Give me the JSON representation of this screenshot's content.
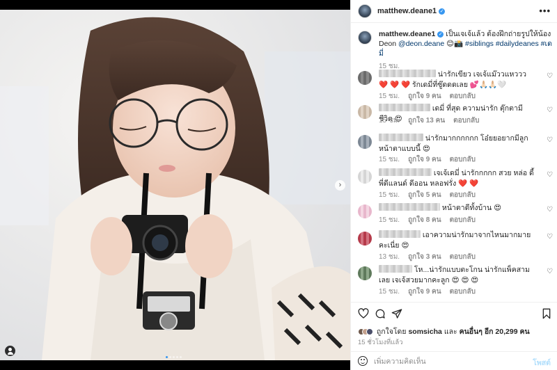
{
  "post": {
    "username": "matthew.deane1",
    "verified": true,
    "more_label": "•••"
  },
  "caption": {
    "username": "matthew.deane1",
    "text": "เป็นเจเจ้แล้ว ต้องฝึกถ่ายรูปให้น้อง Deon",
    "mention": "@deon.deane",
    "emoji": "😊📸",
    "hashtags": [
      "#siblings",
      "#dailydeanes",
      "#เดมี่"
    ],
    "time": "15 ชม."
  },
  "comments": [
    {
      "text": "น่ารักเขียว เจเจ้แม๊ววแหววว ❤️ ❤️ ❤️ รักเดมี่ที่ซู๊ดดดเลย 💕🙏🏻🙏🏻🤍",
      "time": "15 ชม.",
      "likes": "ถูกใจ 9 คน",
      "reply": "ตอบกลับ",
      "av_color": "#6b6b6b"
    },
    {
      "text": "เดมี่ ที่สุด ความน่ารัก ตุ๊กตามีชีวิต 😍",
      "time": "15 ชม.",
      "likes": "ถูกใจ 13 คน",
      "reply": "ตอบกลับ",
      "av_color": "#c9b8a6"
    },
    {
      "text": "น่ารักมากกกกกก โอ๋ยยอยากมีลูกหน้าตาแบบนี้ 😍",
      "time": "15 ชม.",
      "likes": "ถูกใจ 9 คน",
      "reply": "ตอบกลับ",
      "av_color": "#7d8894"
    },
    {
      "text": "เจเจ้เดมี่ น่ารักกกกก สวย หล่อ ดี้ พี่ดีแลนด์ ดีออน หลอฟรั่ง ❤️ ❤️",
      "time": "15 ชม.",
      "likes": "ถูกใจ 5 คน",
      "reply": "ตอบกลับ",
      "av_color": "#d5d5d5"
    },
    {
      "text": "หน้าตาดีทั้งบ้าน 😍",
      "time": "15 ชม.",
      "likes": "ถูกใจ 8 คน",
      "reply": "ตอบกลับ",
      "av_color": "#e8b7cc"
    },
    {
      "text": "เอาความน่ารักมาจากไหนมากมายคะเนี่ย 😍",
      "time": "13 ชม.",
      "likes": "ถูกใจ 3 คน",
      "reply": "ตอบกลับ",
      "av_color": "#b53a4a"
    },
    {
      "text": "โห...น่ารักแบบตะโกน น่ารักแพ็คสามเลย เจเจ้สวยมากคะลูก 😍 😍 😍",
      "time": "15 ชม.",
      "likes": "ถูกใจ 9 คน",
      "reply": "ตอบกลับ",
      "av_color": "#5f7a5c"
    }
  ],
  "likes": {
    "prefix": "ถูกใจโดย",
    "user": "somsicha",
    "and": "และ",
    "others": "คนอื่นๆ อีก 20,299 คน"
  },
  "post_time": "15 ชั่วโมงที่แล้ว",
  "composer": {
    "placeholder": "เพิ่มความคิดเห็น",
    "post_label": "โพสต์"
  },
  "icons": {
    "heart": "heart-icon",
    "comment": "comment-icon",
    "share": "share-icon",
    "save": "bookmark-icon",
    "emoji": "emoji-icon"
  },
  "colors": {
    "link": "#00376b",
    "verified": "#3897f0",
    "meta_gray": "#8e8e8e",
    "post_button_disabled": "#b2dffc",
    "like_red": "#ed4956"
  }
}
